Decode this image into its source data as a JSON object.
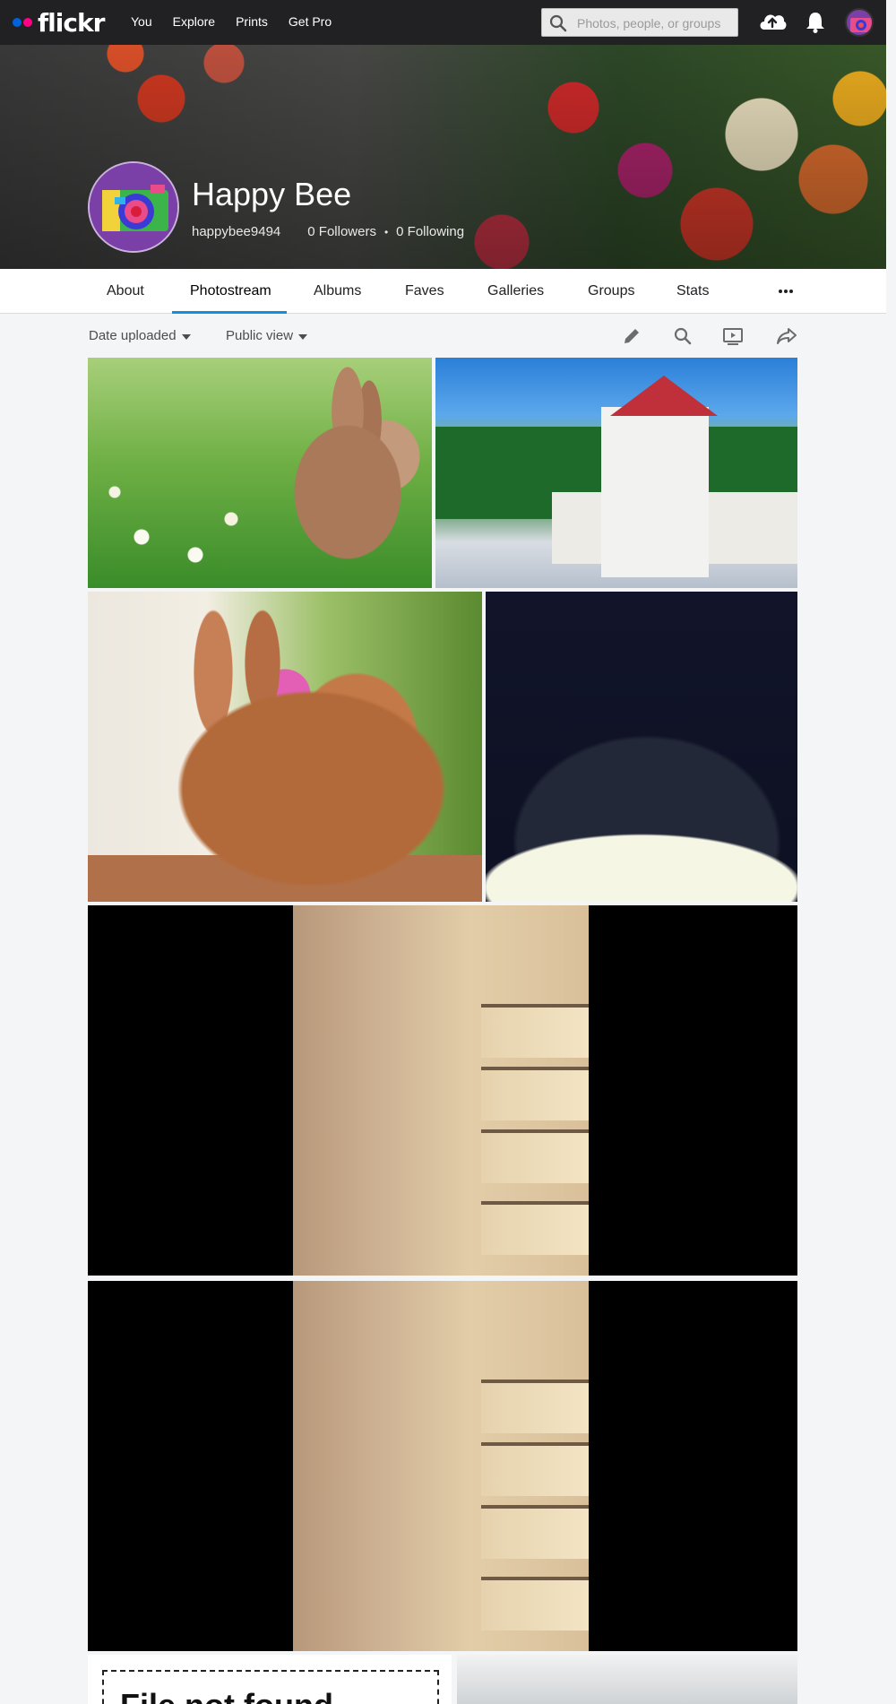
{
  "nav": {
    "logo": "flickr",
    "links": [
      "You",
      "Explore",
      "Prints",
      "Get Pro"
    ],
    "search_placeholder": "Photos, people, or groups"
  },
  "profile": {
    "name": "Happy Bee",
    "username": "happybee9494",
    "followers": "0 Followers",
    "following": "0 Following"
  },
  "tabs": [
    "About",
    "Photostream",
    "Albums",
    "Faves",
    "Galleries",
    "Groups",
    "Stats"
  ],
  "active_tab": "Photostream",
  "toolbar": {
    "sort_label": "Date uploaded",
    "view_label": "Public view"
  },
  "photos": [
    {
      "subject": "rabbit in daisies"
    },
    {
      "subject": "white temple with red roof"
    },
    {
      "subject": "rabbit with pink flower"
    },
    {
      "subject": "lamp in dark"
    },
    {
      "subject": "wooden shelf"
    },
    {
      "subject": "wooden shelf"
    },
    {
      "subject": "file not found"
    },
    {
      "subject": "building"
    }
  ],
  "file_not_found_text": "File not found",
  "colors": {
    "nav_bg": "#212124",
    "accent": "#128fdc",
    "logo_blue": "#0063dc",
    "logo_pink": "#ff0084"
  }
}
